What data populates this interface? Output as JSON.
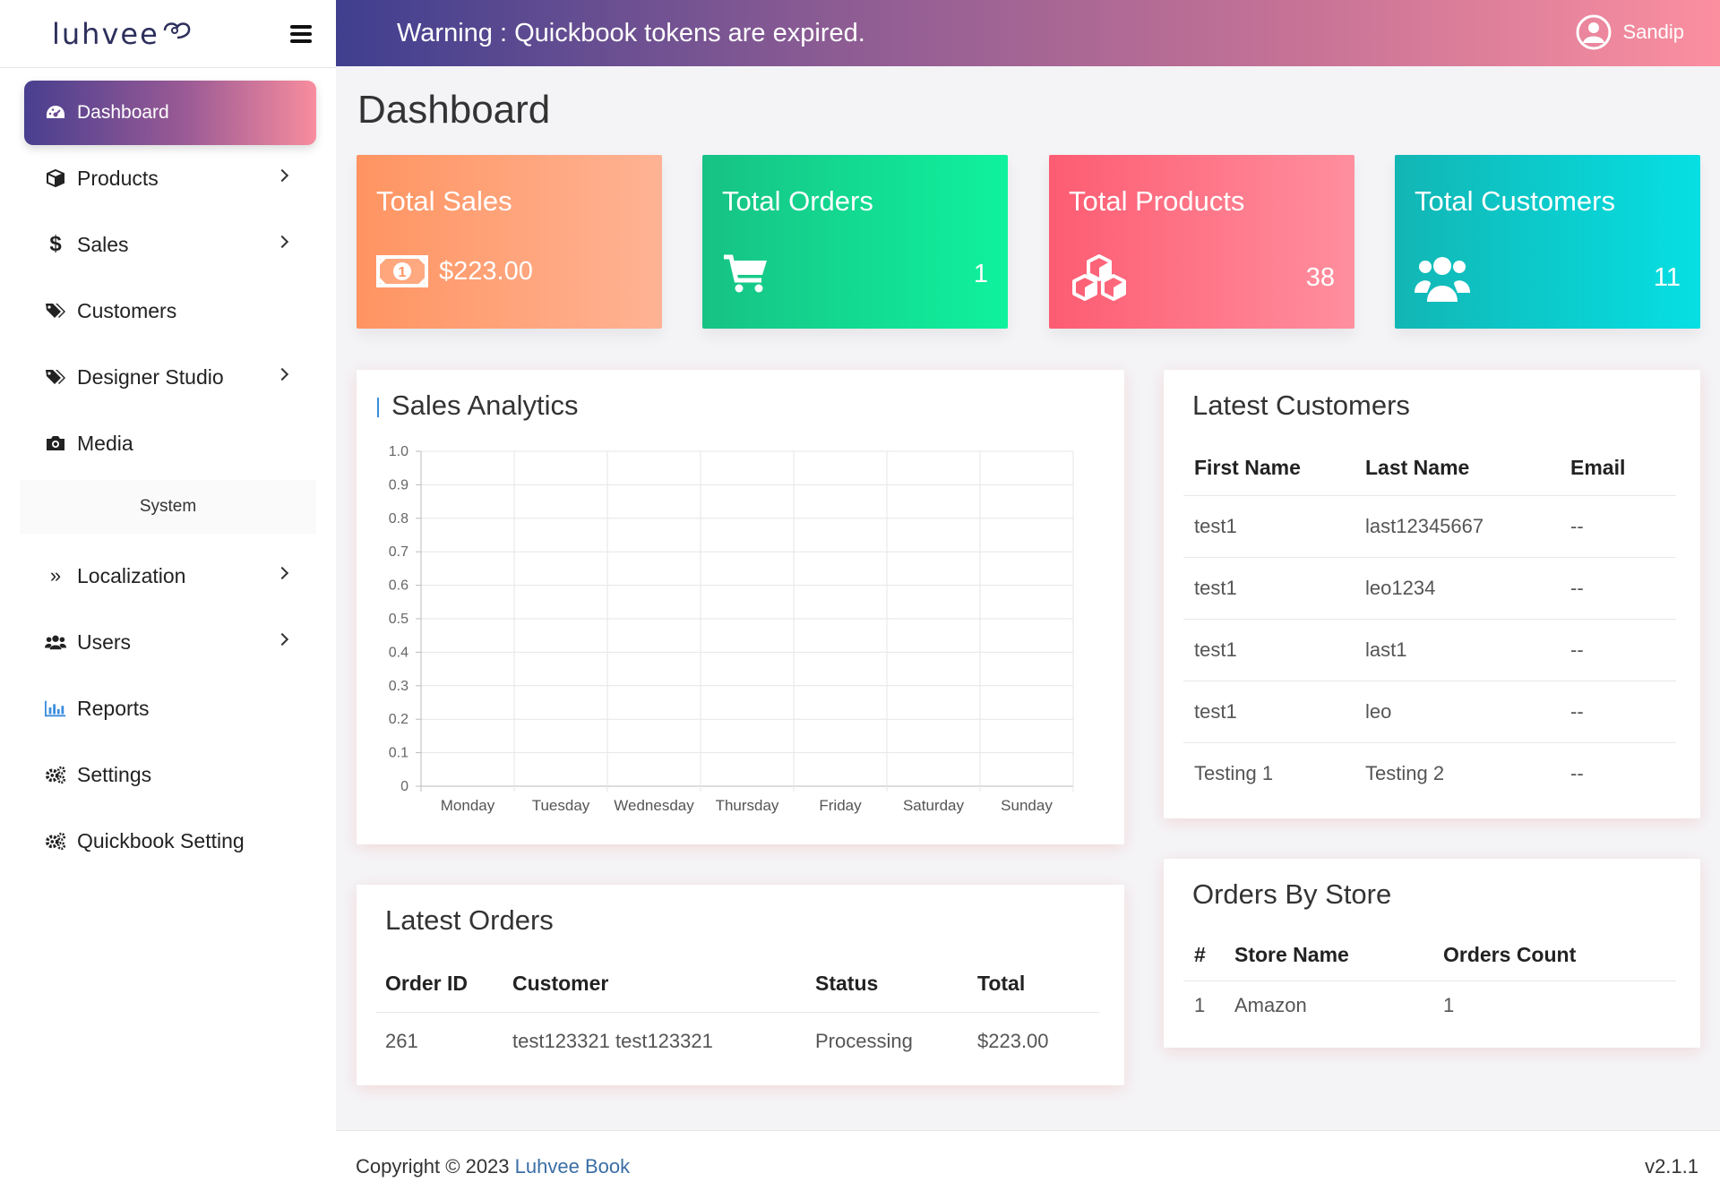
{
  "brand": {
    "name": "luhvee"
  },
  "topbar": {
    "warning": "Warning : Quickbook tokens are expired.",
    "user_name": "Sandip"
  },
  "sidebar": {
    "items": [
      {
        "label": "Dashboard"
      },
      {
        "label": "Products"
      },
      {
        "label": "Sales"
      },
      {
        "label": "Customers"
      },
      {
        "label": "Designer Studio"
      },
      {
        "label": "Media"
      }
    ],
    "section_label": "System",
    "system_items": [
      {
        "label": "Localization"
      },
      {
        "label": "Users"
      },
      {
        "label": "Reports"
      },
      {
        "label": "Settings"
      },
      {
        "label": "Quickbook Setting"
      }
    ]
  },
  "page": {
    "title": "Dashboard"
  },
  "stats": {
    "sales": {
      "title": "Total Sales",
      "value": "$223.00",
      "color": "#ff9461"
    },
    "orders": {
      "title": "Total Orders",
      "value": "1",
      "color": "#17c285"
    },
    "products": {
      "title": "Total Products",
      "value": "38",
      "color": "#fd5c72"
    },
    "customers": {
      "title": "Total Customers",
      "value": "11",
      "color": "#12b6b4"
    }
  },
  "analytics": {
    "title": "Sales Analytics"
  },
  "chart_data": {
    "type": "line",
    "title": "Sales Analytics",
    "categories": [
      "Monday",
      "Tuesday",
      "Wednesday",
      "Thursday",
      "Friday",
      "Saturday",
      "Sunday"
    ],
    "y_ticks": [
      "0",
      "0.1",
      "0.2",
      "0.3",
      "0.4",
      "0.5",
      "0.6",
      "0.7",
      "0.8",
      "0.9",
      "1.0"
    ],
    "ylim": [
      0,
      1
    ],
    "series": [],
    "grid": true
  },
  "latest_customers": {
    "title": "Latest Customers",
    "headers": [
      "First Name",
      "Last Name",
      "Email"
    ],
    "rows": [
      [
        "test1",
        "last12345667",
        "--"
      ],
      [
        "test1",
        "leo1234",
        "--"
      ],
      [
        "test1",
        "last1",
        "--"
      ],
      [
        "test1",
        "leo",
        "--"
      ],
      [
        "Testing 1",
        "Testing 2",
        "--"
      ]
    ]
  },
  "latest_orders": {
    "title": "Latest Orders",
    "headers": [
      "Order ID",
      "Customer",
      "Status",
      "Total"
    ],
    "rows": [
      [
        "261",
        "test123321 test123321",
        "Processing",
        "$223.00"
      ]
    ]
  },
  "orders_by_store": {
    "title": "Orders By Store",
    "headers": [
      "#",
      "Store Name",
      "Orders Count"
    ],
    "rows": [
      [
        "1",
        "Amazon",
        "1"
      ]
    ]
  },
  "footer": {
    "copyright": "Copyright © 2023",
    "link": "Luhvee Book",
    "version": "v2.1.1"
  },
  "colors": {
    "accent_start": "#483f8f",
    "accent_end": "#f88d9e",
    "link": "#3a6ea5"
  }
}
